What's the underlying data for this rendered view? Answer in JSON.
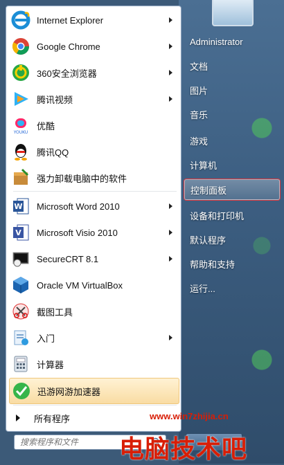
{
  "programs": [
    {
      "label": "Internet Explorer",
      "icon": "internet-explorer-icon",
      "submenu": true
    },
    {
      "label": "Google Chrome",
      "icon": "chrome-icon",
      "submenu": true
    },
    {
      "label": "360安全浏览器",
      "icon": "360-browser-icon",
      "submenu": true
    },
    {
      "label": "腾讯视频",
      "icon": "tencent-video-icon",
      "submenu": true
    },
    {
      "label": "优酷",
      "icon": "youku-icon",
      "submenu": false
    },
    {
      "label": "腾讯QQ",
      "icon": "qq-icon",
      "submenu": false
    },
    {
      "label": "强力卸载电脑中的软件",
      "icon": "uninstall-icon",
      "submenu": false
    },
    {
      "label": "Microsoft Word 2010",
      "icon": "word-icon",
      "submenu": true
    },
    {
      "label": "Microsoft Visio 2010",
      "icon": "visio-icon",
      "submenu": true
    },
    {
      "label": "SecureCRT 8.1",
      "icon": "securecrt-icon",
      "submenu": true
    },
    {
      "label": "Oracle VM VirtualBox",
      "icon": "virtualbox-icon",
      "submenu": false
    },
    {
      "label": "截图工具",
      "icon": "snipping-tool-icon",
      "submenu": false
    },
    {
      "label": "入门",
      "icon": "getting-started-icon",
      "submenu": true
    },
    {
      "label": "计算器",
      "icon": "calculator-icon",
      "submenu": false
    },
    {
      "label": "迅游网游加速器",
      "icon": "xunyou-icon",
      "submenu": false,
      "highlighted": true
    }
  ],
  "all_programs_label": "所有程序",
  "search": {
    "placeholder": "搜索程序和文件"
  },
  "right_items": [
    {
      "label": "Administrator"
    },
    {
      "label": "文档"
    },
    {
      "label": "图片"
    },
    {
      "label": "音乐"
    },
    {
      "label": "游戏"
    },
    {
      "label": "计算机"
    },
    {
      "label": "控制面板",
      "highlighted": true
    },
    {
      "label": "设备和打印机"
    },
    {
      "label": "默认程序"
    },
    {
      "label": "帮助和支持"
    },
    {
      "label": "运行..."
    }
  ],
  "watermark": {
    "url": "www.win7zhijia.cn",
    "text": "电脑技术吧"
  },
  "colors": {
    "highlight_border": "#d9363c",
    "hover_bg": "#f9dca3",
    "pane_blue": "#3d5f82"
  }
}
